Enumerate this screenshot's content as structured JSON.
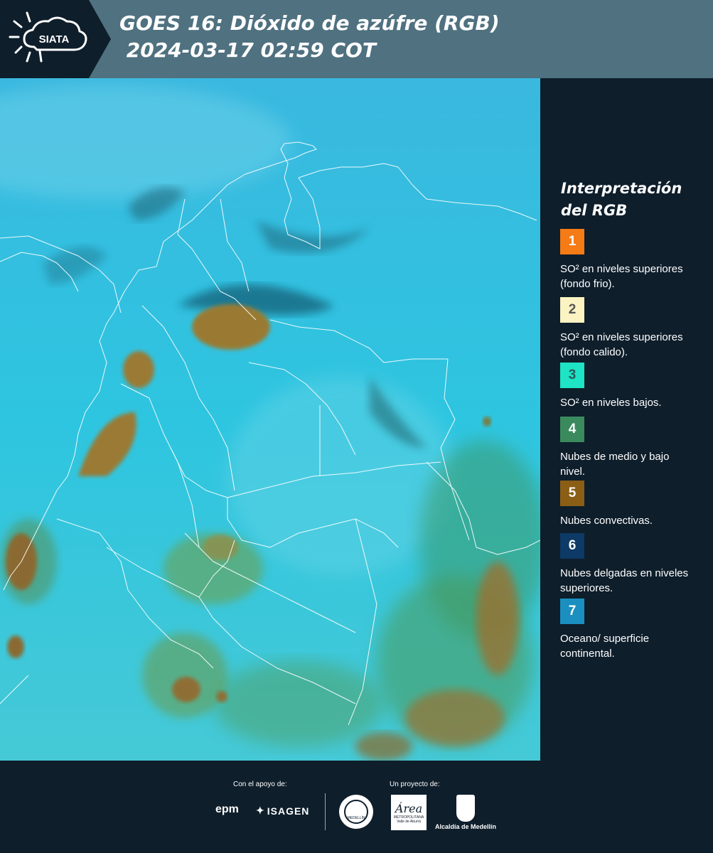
{
  "header": {
    "logo_text": "SIATA",
    "title_line1": "GOES 16: Dióxido de azúfre (RGB)",
    "title_line2": " 2024-03-17 02:59 COT"
  },
  "legend": {
    "title": "Interpretación del RGB",
    "items": [
      {
        "number": "1",
        "color": "#f47b16",
        "number_color": "#ffffff",
        "text": "SO² en niveles superiores (fondo frio)."
      },
      {
        "number": "2",
        "color": "#fbf3c1",
        "number_color": "#555555",
        "text": "SO² en niveles superiores (fondo calido)."
      },
      {
        "number": "3",
        "color": "#1ee3c4",
        "number_color": "#2a5a5a",
        "text": "SO² en niveles bajos."
      },
      {
        "number": "4",
        "color": "#3a8a5e",
        "number_color": "#ffffff",
        "text": "Nubes de medio y bajo nivel."
      },
      {
        "number": "5",
        "color": "#8b5e16",
        "number_color": "#ffffff",
        "text": "Nubes convectivas."
      },
      {
        "number": "6",
        "color": "#0d3a66",
        "number_color": "#ffffff",
        "text": "Nubes delgadas en niveles superiores."
      },
      {
        "number": "7",
        "color": "#1a8fc0",
        "number_color": "#ffffff",
        "text": "Oceano/ superficie continental."
      }
    ]
  },
  "footer": {
    "support_label": "Con el apoyo de:",
    "project_label": "Un proyecto de:",
    "sponsor1": "epm",
    "sponsor2": "ISAGEN",
    "partner1": "METROPOLITANA Valle de Aburrá",
    "partner1_title": "Área",
    "partner2": "Alcaldía de Medellín",
    "seal_text": "MEDELLÍN"
  }
}
